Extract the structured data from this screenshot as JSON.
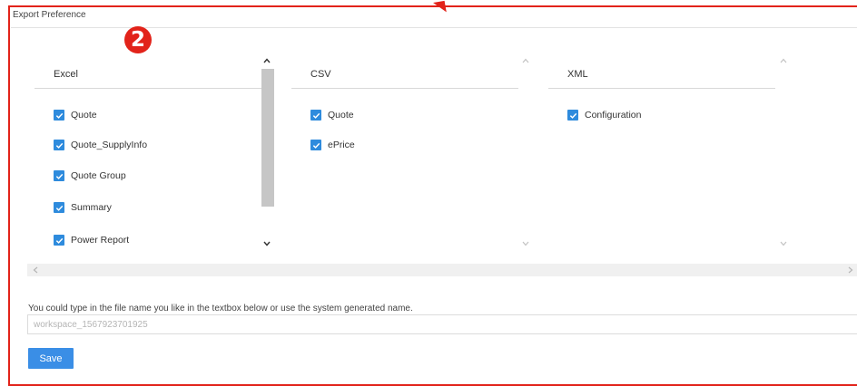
{
  "panel": {
    "title": "Export Preference"
  },
  "badge": {
    "step": "2"
  },
  "columns": [
    {
      "header": "Excel",
      "items": [
        "Quote",
        "Quote_SupplyInfo",
        "Quote Group",
        "Summary",
        "Power Report"
      ]
    },
    {
      "header": "CSV",
      "items": [
        "Quote",
        "ePrice"
      ]
    },
    {
      "header": "XML",
      "items": [
        "Configuration"
      ]
    }
  ],
  "file": {
    "hint": "You could type in the file name you like in the textbox below or use the system generated name.",
    "placeholder": "workspace_1567923701925"
  },
  "save_label": "Save",
  "colors": {
    "accent": "#e2231a",
    "checkbox": "#2e8bdd",
    "button": "#3a8ee6"
  },
  "icons": [
    "check-icon",
    "chevron-up-icon",
    "chevron-down-icon",
    "chevron-left-icon",
    "chevron-right-icon"
  ]
}
